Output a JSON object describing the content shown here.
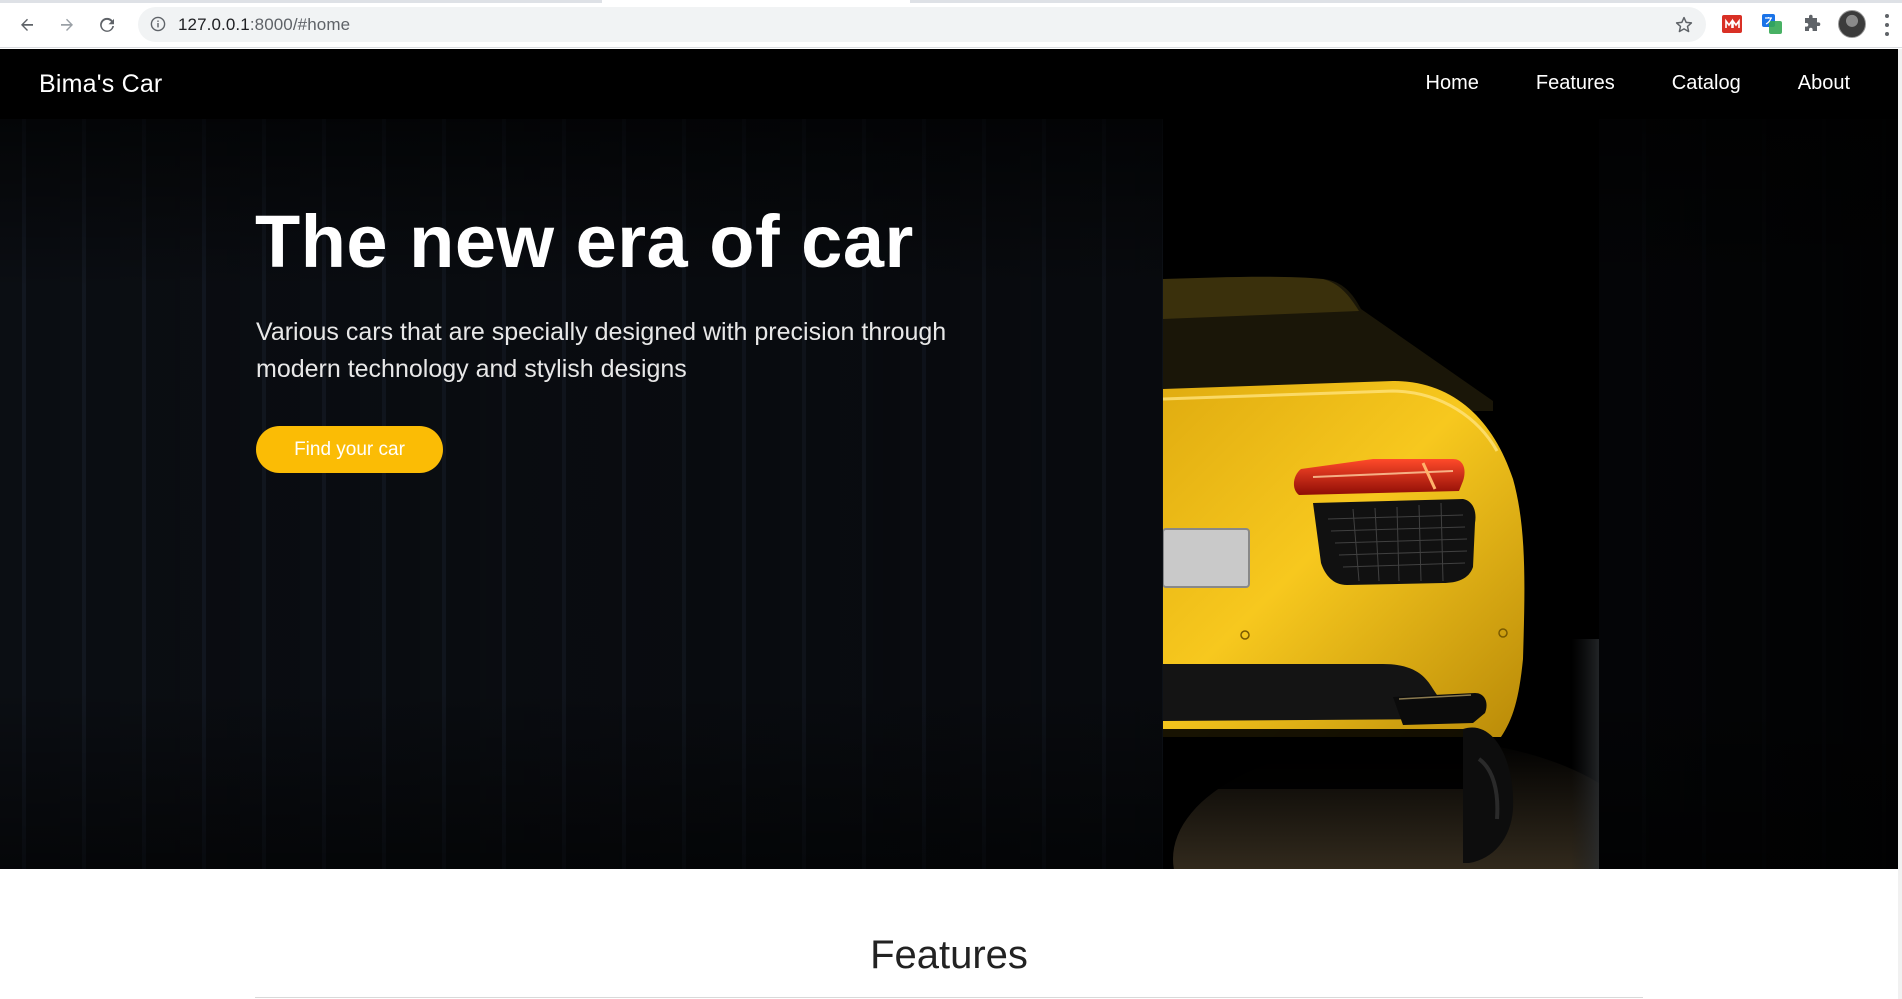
{
  "browser": {
    "url_host": "127.0.0.1",
    "url_rest": ":8000/#home",
    "back_icon": "back-arrow-icon",
    "forward_icon": "forward-arrow-icon",
    "reload_icon": "reload-icon",
    "site_info_icon": "info-icon",
    "bookmark_icon": "star-icon",
    "extensions": [
      "red-extension-icon",
      "translate-extension-icon",
      "puzzle-extensions-icon"
    ],
    "menu_icon": "kebab-menu-icon"
  },
  "navbar": {
    "brand": "Bima's Car",
    "links": [
      "Home",
      "Features",
      "Catalog",
      "About"
    ]
  },
  "hero": {
    "title": "The new era of car",
    "subtitle": "Various cars that are specially designed with precision through modern technology and stylish designs",
    "cta_label": "Find your car",
    "image": "yellow-sports-car-rear-photo"
  },
  "features": {
    "title": "Features"
  },
  "colors": {
    "accent": "#fbbc05",
    "navbar_bg": "#000000",
    "hero_bg": "#0b0e13",
    "car_yellow": "#f2c21a"
  }
}
